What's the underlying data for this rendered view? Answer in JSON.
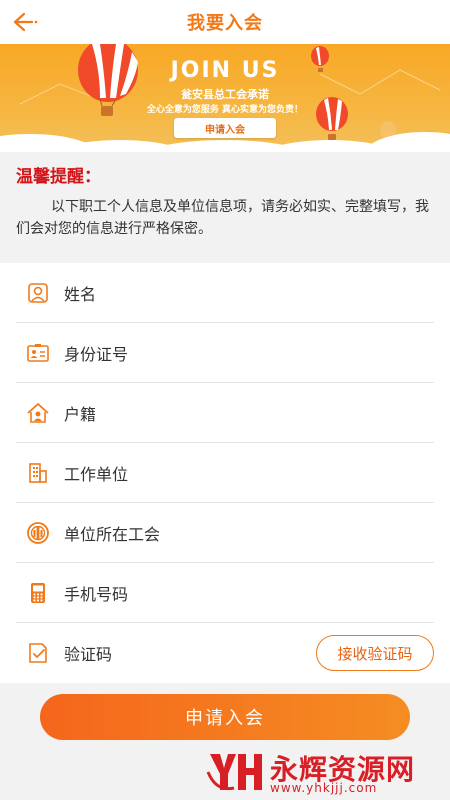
{
  "header": {
    "title": "我要入会",
    "back_icon": "back-arrow-icon"
  },
  "banner": {
    "headline": "JOIN US",
    "promise": "瓮安县总工会承诺",
    "slogan": "全心全意为您服务   真心实意为您负责！",
    "button_label": "申请入会"
  },
  "notice": {
    "title": "温馨提醒：",
    "text": "以下职工个人信息及单位信息项，请务必如实、完整填写，我们会对您的信息进行严格保密。"
  },
  "form": {
    "fields": [
      {
        "label": "姓名",
        "icon": "user-card-icon"
      },
      {
        "label": "身份证号",
        "icon": "id-card-icon"
      },
      {
        "label": "户籍",
        "icon": "house-icon"
      },
      {
        "label": "工作单位",
        "icon": "building-icon"
      },
      {
        "label": "单位所在工会",
        "icon": "union-emblem-icon"
      },
      {
        "label": "手机号码",
        "icon": "phone-icon"
      },
      {
        "label": "验证码",
        "icon": "checklist-icon"
      }
    ],
    "get_code_label": "接收验证码"
  },
  "submit_label": "申请入会",
  "watermark": {
    "name": "永辉资源网",
    "url": "www.yhkjjj.com"
  },
  "colors": {
    "accent": "#f07a1a",
    "notice_title": "#d4161a",
    "background": "#f2f2f2"
  }
}
